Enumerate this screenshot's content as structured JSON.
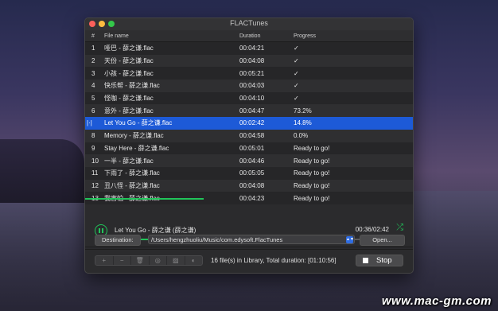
{
  "window": {
    "title": "FLACTunes"
  },
  "columns": {
    "num": "#",
    "name": "File name",
    "duration": "Duration",
    "progress": "Progress"
  },
  "rows": [
    {
      "num": "1",
      "name": "哑巴 - 薛之谦.flac",
      "duration": "00:04:21",
      "progress": "✓"
    },
    {
      "num": "2",
      "name": "天份 - 薛之谦.flac",
      "duration": "00:04:08",
      "progress": "✓"
    },
    {
      "num": "3",
      "name": "小孩 - 薛之谦.flac",
      "duration": "00:05:21",
      "progress": "✓"
    },
    {
      "num": "4",
      "name": "快乐帮 - 薛之谦.flac",
      "duration": "00:04:03",
      "progress": "✓"
    },
    {
      "num": "5",
      "name": "怪咖 - 薛之谦.flac",
      "duration": "00:04:10",
      "progress": "✓"
    },
    {
      "num": "6",
      "name": "意外 - 薛之谦.flac",
      "duration": "00:04:47",
      "progress": "73.2%"
    },
    {
      "num": "",
      "name": "Let You Go - 薛之谦.flac",
      "duration": "00:02:42",
      "progress": "14.8%",
      "selected": true
    },
    {
      "num": "8",
      "name": "Memory - 薛之谦.flac",
      "duration": "00:04:58",
      "progress": "0.0%"
    },
    {
      "num": "9",
      "name": "Stay Here - 薛之谦.flac",
      "duration": "00:05:01",
      "progress": "Ready to go!"
    },
    {
      "num": "10",
      "name": "一半 - 薛之谦.flac",
      "duration": "00:04:46",
      "progress": "Ready to go!"
    },
    {
      "num": "11",
      "name": "下雨了 - 薛之谦.flac",
      "duration": "00:05:05",
      "progress": "Ready to go!"
    },
    {
      "num": "12",
      "name": "丑八怪 - 薛之谦.flac",
      "duration": "00:04:08",
      "progress": "Ready to go!"
    },
    {
      "num": "13",
      "name": "我害怕 - 薛之谦.flac",
      "duration": "00:04:23",
      "progress": "Ready to go!"
    }
  ],
  "player": {
    "now_playing": "Let You Go - 薛之谦 (薛之谦)",
    "time": "00:36/02:42",
    "position_fraction": 0.222
  },
  "destination": {
    "label": "Destination:",
    "path": "/Users/hengzhuoliu/Music/com.edysoft.FlacTunes",
    "open_label": "Open..."
  },
  "toolbar": {
    "buttons": [
      "add-icon",
      "remove-icon",
      "trash-icon",
      "info-icon",
      "image-icon",
      "globe-icon"
    ],
    "status": "16 file(s) in Library, Total duration: [01:10:56]",
    "stop_label": "Stop"
  },
  "overall_progress_fraction": 0.36,
  "watermark": "www.mac-gm.com",
  "colors": {
    "accent": "#21c45a",
    "selection": "#1d5ad7"
  }
}
